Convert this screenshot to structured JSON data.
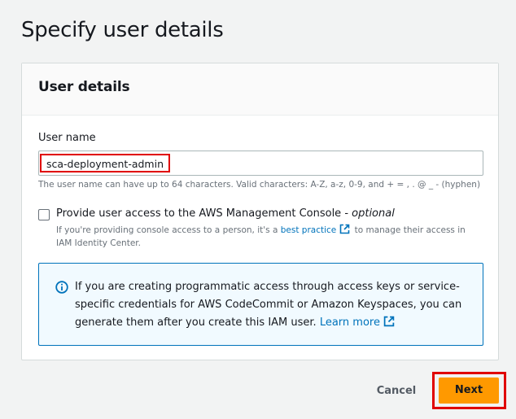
{
  "page": {
    "title": "Specify user details"
  },
  "panel": {
    "title": "User details",
    "user_name": {
      "label": "User name",
      "value": "sca-deployment-admin",
      "hint": "The user name can have up to 64 characters. Valid characters: A-Z, a-z, 0-9, and + = , . @ _ - (hyphen)"
    },
    "console_access": {
      "checked": false,
      "label": "Provide user access to the AWS Management Console - ",
      "label_optional": "optional",
      "desc_before": "If you're providing console access to a person, it's a ",
      "desc_link": "best practice",
      "desc_after": " to manage their access in IAM Identity Center."
    },
    "info": {
      "text": "If you are creating programmatic access through access keys or service-specific credentials for AWS CodeCommit or Amazon Keyspaces, you can generate them after you create this IAM user.",
      "link": "Learn more"
    }
  },
  "footer": {
    "cancel_label": "Cancel",
    "next_label": "Next"
  },
  "colors": {
    "accent": "#ff9900",
    "link": "#0073bb",
    "highlight": "#e00000"
  }
}
